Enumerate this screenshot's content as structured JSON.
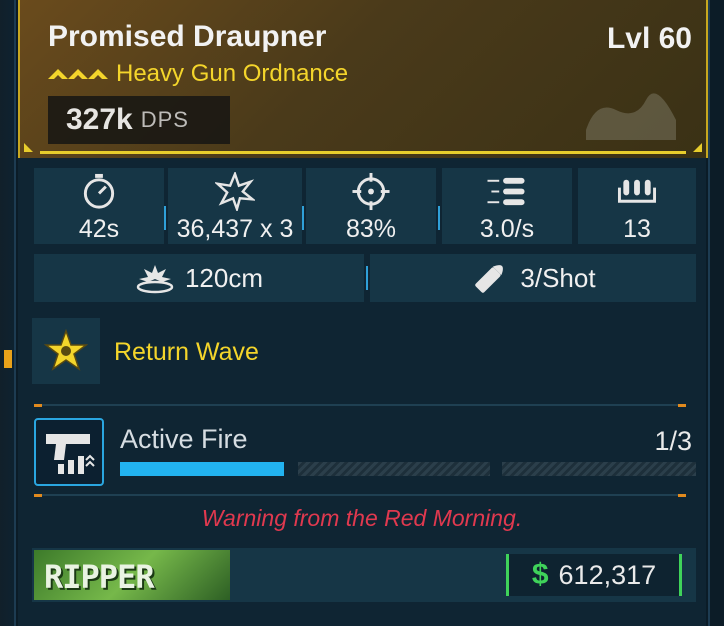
{
  "weapon": {
    "name": "Promised Draupner",
    "level": "Lvl 60",
    "type": "Heavy Gun Ordnance",
    "dps_value": "327k",
    "dps_unit": "DPS"
  },
  "stats": [
    {
      "icon": "timer-icon",
      "value": "42s"
    },
    {
      "icon": "impact-icon",
      "value": "36,437 x 3"
    },
    {
      "icon": "crosshair-icon",
      "value": "83%"
    },
    {
      "icon": "fire-rate-icon",
      "value": "3.0/s"
    },
    {
      "icon": "magazine-icon",
      "value": "13"
    }
  ],
  "secondary_stats": [
    {
      "icon": "splash-radius-icon",
      "value": "120cm"
    },
    {
      "icon": "ammo-cost-icon",
      "value": "3/Shot"
    }
  ],
  "perk": {
    "icon": "star-burst-icon",
    "label": "Return Wave"
  },
  "mod": {
    "icon": "pistol-upgrade-icon",
    "name": "Active Fire",
    "count": "1/3",
    "progress_fraction": 0.333
  },
  "flavor_text": "Warning from the Red Morning.",
  "manufacturer": {
    "logo_text": "RIPPER"
  },
  "price": {
    "currency_icon": "dollar-icon",
    "amount": "612,317"
  },
  "colors": {
    "accent_yellow": "#f4d52b",
    "accent_blue": "#22b3f0",
    "flavor_red": "#e0394f",
    "price_green": "#3fd35a"
  }
}
